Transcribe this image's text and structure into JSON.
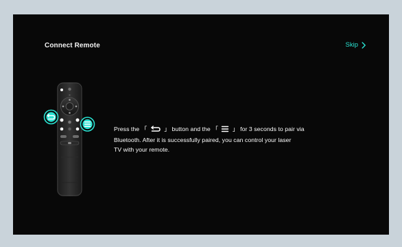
{
  "header": {
    "title": "Connect Remote",
    "skip_label": "Skip"
  },
  "instruction": {
    "text_before_back": "Press the",
    "bracket_left": "「",
    "bracket_right": "」",
    "text_between": "button and the",
    "text_after_menu_line1": "for 3 seconds to pair via",
    "text_line2": "Bluetooth. After it is successfully paired, you can control your laser",
    "text_line3": "TV with your remote."
  },
  "icons": {
    "back": "back-arrow-icon",
    "menu": "menu-icon",
    "skip": "chevron-right-icon",
    "remote": "remote-control-icon"
  },
  "colors": {
    "accent": "#29e3d2",
    "background": "#080808",
    "page": "#c9d3da",
    "text": "#ffffff"
  }
}
